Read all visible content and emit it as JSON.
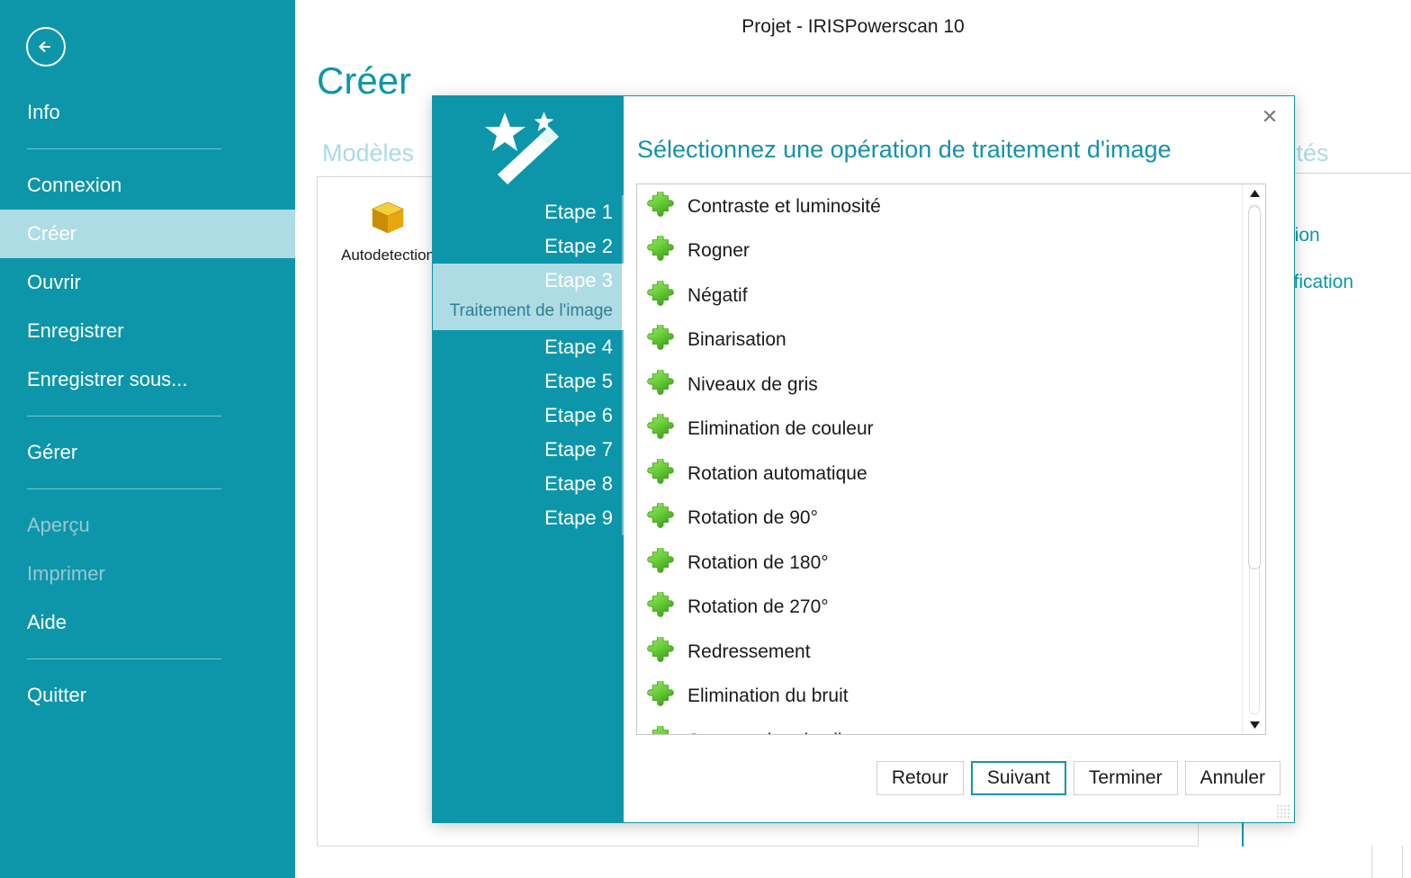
{
  "window": {
    "title": "Projet - IRISPowerscan 10"
  },
  "sidebar": {
    "back_icon": "back-arrow-icon",
    "items": [
      {
        "label": "Info",
        "state": "normal"
      },
      {
        "label": "Connexion",
        "state": "normal"
      },
      {
        "label": "Créer",
        "state": "selected"
      },
      {
        "label": "Ouvrir",
        "state": "normal"
      },
      {
        "label": "Enregistrer",
        "state": "normal"
      },
      {
        "label": "Enregistrer sous...",
        "state": "normal"
      },
      {
        "label": "Gérer",
        "state": "normal"
      },
      {
        "label": "Aperçu",
        "state": "disabled"
      },
      {
        "label": "Imprimer",
        "state": "disabled"
      },
      {
        "label": "Aide",
        "state": "normal"
      },
      {
        "label": "Quitter",
        "state": "normal"
      }
    ]
  },
  "main": {
    "page_title": "Créer",
    "models_label": "Modèles",
    "properties_label": "...tés",
    "tile": {
      "label": "Autodetection",
      "icon": "gold-cube-icon"
    },
    "properties": [
      "création",
      "modification"
    ]
  },
  "dialog": {
    "close_icon": "close-icon",
    "wand_icon": "magic-wand-icon",
    "title": "Sélectionnez une opération de traitement d'image",
    "steps": [
      {
        "num": "Etape 1",
        "desc": "",
        "active": false
      },
      {
        "num": "Etape 2",
        "desc": "",
        "active": false
      },
      {
        "num": "Etape 3",
        "desc": "Traitement de l'image",
        "active": true
      },
      {
        "num": "Etape 4",
        "desc": "",
        "active": false
      },
      {
        "num": "Etape 5",
        "desc": "",
        "active": false
      },
      {
        "num": "Etape 6",
        "desc": "",
        "active": false
      },
      {
        "num": "Etape 7",
        "desc": "",
        "active": false
      },
      {
        "num": "Etape 8",
        "desc": "",
        "active": false
      },
      {
        "num": "Etape 9",
        "desc": "",
        "active": false
      }
    ],
    "operations": [
      "Contraste et luminosité",
      "Rogner",
      "Négatif",
      "Binarisation",
      "Niveaux de gris",
      "Elimination de couleur",
      "Rotation automatique",
      "Rotation de 90°",
      "Rotation de 180°",
      "Rotation de 270°",
      "Redressement",
      "Elimination du bruit",
      "Suppression des lignes"
    ],
    "scrollbar": {
      "up_icon": "scroll-up-arrow-icon",
      "down_icon": "scroll-down-arrow-icon",
      "thumb_position_pct": 0
    },
    "buttons": [
      {
        "label": "Retour",
        "focused": false
      },
      {
        "label": "Suivant",
        "focused": true
      },
      {
        "label": "Terminer",
        "focused": false
      },
      {
        "label": "Annuler",
        "focused": false
      }
    ]
  },
  "colors": {
    "teal": "#0d96aa",
    "teal_light": "#aedce5",
    "title_teal": "#1592ab",
    "muted": "#a9dbe6",
    "green_puzzle": "#63c838",
    "gold_cube": "#e0a800"
  }
}
